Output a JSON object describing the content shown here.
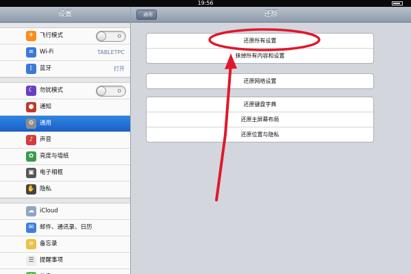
{
  "status_bar": {
    "time": "19:56"
  },
  "sidebar": {
    "title": "设置",
    "items": [
      {
        "label": "飞行模式",
        "icon": "airplane-icon",
        "color": "#ff8c1a",
        "toggle": "O"
      },
      {
        "label": "Wi-Fi",
        "icon": "wifi-icon",
        "color": "#3b78d8",
        "value": "TABLETPC"
      },
      {
        "label": "蓝牙",
        "icon": "bluetooth-icon",
        "color": "#3b78d8",
        "value": "打开"
      },
      {
        "label": "勿扰模式",
        "icon": "moon-icon",
        "color": "#6a3fc1",
        "toggle": "O"
      },
      {
        "label": "通知",
        "icon": "notifications-icon",
        "color": "#c0392b"
      },
      {
        "label": "通用",
        "icon": "gear-icon",
        "color": "#8d8d8d",
        "selected": true
      },
      {
        "label": "声音",
        "icon": "speaker-icon",
        "color": "#d63b3b"
      },
      {
        "label": "亮度与墙纸",
        "icon": "flower-icon",
        "color": "#3a9a4d"
      },
      {
        "label": "电子相框",
        "icon": "picture-frame-icon",
        "color": "#555555"
      },
      {
        "label": "隐私",
        "icon": "hand-icon",
        "color": "#444444"
      },
      {
        "label": "iCloud",
        "icon": "cloud-icon",
        "color": "#8ea6c3"
      },
      {
        "label": "邮件、通讯录、日历",
        "icon": "mail-icon",
        "color": "#3d7fdc"
      },
      {
        "label": "备忘录",
        "icon": "notes-icon",
        "color": "#e7c24a"
      },
      {
        "label": "提醒事项",
        "icon": "reminders-icon",
        "color": "#eeeeee"
      },
      {
        "label": "信息",
        "icon": "messages-icon",
        "color": "#4bc34b"
      }
    ]
  },
  "main": {
    "title": "还原",
    "back_label": "通用",
    "groups": [
      [
        "还原所有设置",
        "抹掉所有内容和设置"
      ],
      [
        "还原网络设置"
      ],
      [
        "还原键盘字典",
        "还原主屏幕布局",
        "还原位置与隐私"
      ]
    ]
  },
  "colors": {
    "annotation": "#e0182a",
    "selected": "#1f6fd6"
  }
}
